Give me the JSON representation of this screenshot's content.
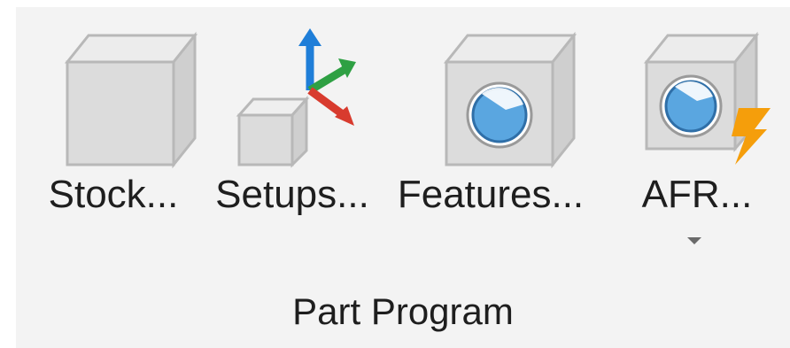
{
  "ribbon_group": {
    "title": "Part Program",
    "tools": [
      {
        "label": "Stock...",
        "icon": "stock-box-icon"
      },
      {
        "label": "Setups...",
        "icon": "setup-axes-icon"
      },
      {
        "label": "Features...",
        "icon": "feature-box-icon"
      },
      {
        "label": "AFR...",
        "icon": "afr-lightning-icon",
        "has_dropdown": true
      }
    ]
  },
  "colors": {
    "group_background": "#f3f3f3",
    "box_face": "#dedede",
    "feature_blue": "#5aa6e0",
    "axis_blue": "#1f7ed8",
    "axis_green": "#2ea043",
    "axis_red": "#d83b2e",
    "lightning_orange": "#f59e0b"
  }
}
